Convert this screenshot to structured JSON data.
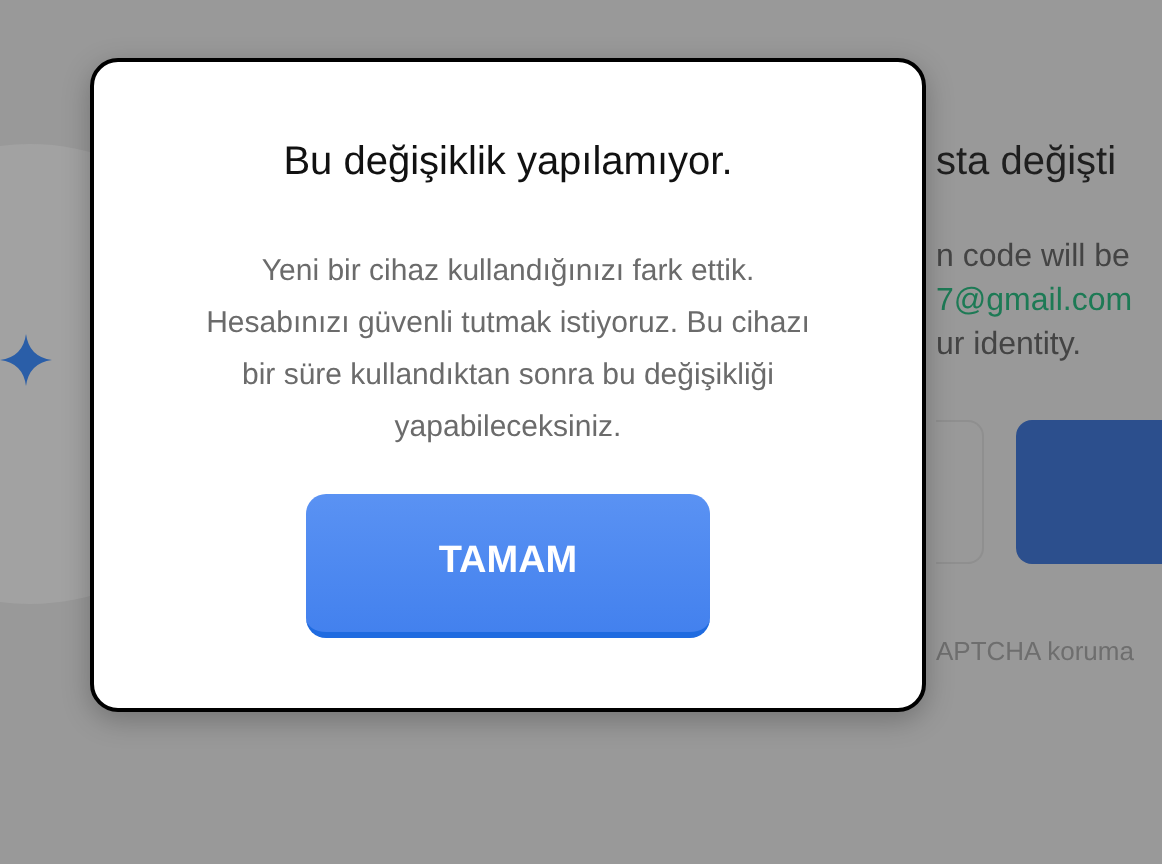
{
  "background_page": {
    "heading": "sta değişti",
    "lines": [
      {
        "kind": "plain",
        "text": "n code will be"
      },
      {
        "kind": "email",
        "text": "7@gmail.com"
      },
      {
        "kind": "plain",
        "text": "ur identity."
      }
    ],
    "captcha_note": "APTCHA koruma"
  },
  "dialog": {
    "title": "Bu değişiklik yapılamıyor.",
    "message": "Yeni bir cihaz kullandığınızı fark ettik. Hesabınızı güvenli tutmak istiyoruz. Bu cihazı bir süre kullandıktan sonra bu değişikliği yapabileceksiniz.",
    "button": "TAMAM"
  }
}
